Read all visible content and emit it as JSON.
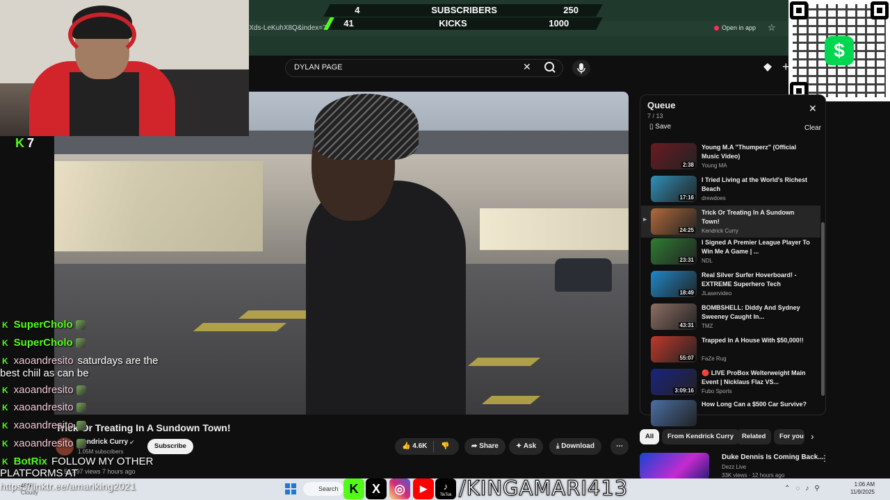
{
  "overlay": {
    "goal_subs_current": "4",
    "goal_subs_label": "SUBSCRIBERS",
    "goal_subs_target": "250",
    "goal_kicks_current": "41",
    "goal_kicks_label": "KICKS",
    "goal_kicks_target": "1000",
    "kick_count": "7",
    "social_handle": "/KINGAMARI413",
    "tiktok_label": "TikTok",
    "accent": "#53fc18"
  },
  "browser": {
    "url": "jXds-LeKuhX8Q&index=7",
    "open_in_app": "Open in app"
  },
  "search": {
    "value": "DYLAN PAGE"
  },
  "video": {
    "title": "Trick Or Treating In A Sundown Town!",
    "channel": "Kendrick Curry",
    "subscribers": "1.05M subscribers",
    "subscribe": "Subscribe",
    "likes": "4.6K",
    "share": "Share",
    "ask": "Ask",
    "download": "Download",
    "meta": "54,497 views 7 hours ago"
  },
  "queue": {
    "title": "Queue",
    "position": "7 / 13",
    "save": "Save",
    "clear": "Clear",
    "items": [
      {
        "title": "Young M.A \"Thumperz\" (Official Music Video)",
        "channel": "Young MA",
        "duration": "2:38",
        "color": "#6a1a22"
      },
      {
        "title": "I Tried Living at the World's Richest Beach",
        "channel": "drewdoes",
        "duration": "17:16",
        "color": "#2f8fb8"
      },
      {
        "title": "Trick Or Treating In A Sundown Town!",
        "channel": "Kendrick Curry",
        "duration": "24:25",
        "color": "#b06a3a"
      },
      {
        "title": "I Signed A Premier League Player To Win Me A Game | ...",
        "channel": "NDL",
        "duration": "23:31",
        "color": "#2e7d32"
      },
      {
        "title": "Real Silver Surfer Hoverboard! - EXTREME Superhero Tech",
        "channel": "JLaservideo",
        "duration": "18:49",
        "color": "#1e88c8"
      },
      {
        "title": "BOMBSHELL: Diddy And Sydney Sweeney Caught In...",
        "channel": "TMZ",
        "duration": "43:31",
        "color": "#8d6e63"
      },
      {
        "title": "Trapped In A House With $50,000!!",
        "channel": "FaZe Rug",
        "duration": "55:07",
        "color": "#c0392b"
      },
      {
        "title": "🔴 LIVE ProBox Welterweight Main Event | Nicklaus Flaz VS...",
        "channel": "Fubo Sports",
        "duration": "3:09:16",
        "color": "#1a237e"
      },
      {
        "title": "How Long Can a $500 Car Survive?",
        "channel": "",
        "duration": "",
        "color": "#4a6fa5"
      }
    ]
  },
  "chips": [
    "All",
    "From Kendrick Curry",
    "Related",
    "For you"
  ],
  "recommended": {
    "title": "Duke Dennis Is Coming Back...",
    "channel": "Dezz Live",
    "meta": "33K views · 12 hours ago"
  },
  "chat": [
    {
      "user": "SuperCholo",
      "msg": ""
    },
    {
      "user": "SuperCholo",
      "msg": ""
    },
    {
      "user": "xaoandresito",
      "msg": "saturdays are the"
    },
    {
      "user": "",
      "msg": "best chiil as can be"
    },
    {
      "user": "xaoandresito",
      "msg": ""
    },
    {
      "user": "xaoandresito",
      "msg": ""
    },
    {
      "user": "xaoandresito",
      "msg": ""
    },
    {
      "user": "xaoandresito",
      "msg": ""
    },
    {
      "user": "BotRix",
      "msg": "FOLLOW MY OTHER"
    },
    {
      "user": "",
      "msg": "PLATFORMS AT"
    }
  ],
  "taskbar": {
    "link": "https://linktr.ee/amariking2021",
    "weather": "49°F",
    "weather_desc": "Cloudy",
    "search": "Search",
    "time": "1:06 AM",
    "date": "11/9/2025"
  }
}
